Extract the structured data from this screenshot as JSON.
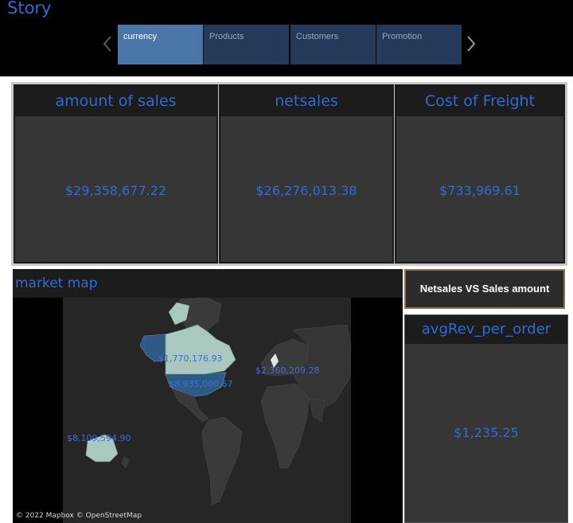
{
  "story": {
    "title": "Story"
  },
  "tabs": [
    {
      "label": "currency",
      "active": true
    },
    {
      "label": "Products",
      "active": false
    },
    {
      "label": "Customers",
      "active": false
    },
    {
      "label": "Promotion",
      "active": false
    }
  ],
  "kpis": {
    "sales": {
      "title": "amount of sales",
      "value": "$29,358,677.22"
    },
    "netsales": {
      "title": "netsales",
      "value": "$26,276,013.38"
    },
    "freight": {
      "title": "Cost of Freight",
      "value": "$733,969.61"
    }
  },
  "map": {
    "title": "market map",
    "labels": {
      "canada": "$1,770,176.93",
      "europe": "$2,360,209.28",
      "usa": "$8,935,000.67",
      "australia": "$8,109,594.90"
    },
    "attribution": "© 2022 Mapbox © OpenStreetMap"
  },
  "netsales_vs_sales_button": "Netsales VS Sales amount",
  "avg_rev": {
    "title": "avgRev_per_order",
    "value": "$1,235.25"
  },
  "colors": {
    "accent": "#2f6bd8",
    "active_tab": "#4b76a8",
    "tab": "#243a5a",
    "panel": "#363636",
    "header": "#1c1c1c",
    "highlight_land": "#a9c8c0",
    "dark_highlight": "#2e5a86"
  }
}
